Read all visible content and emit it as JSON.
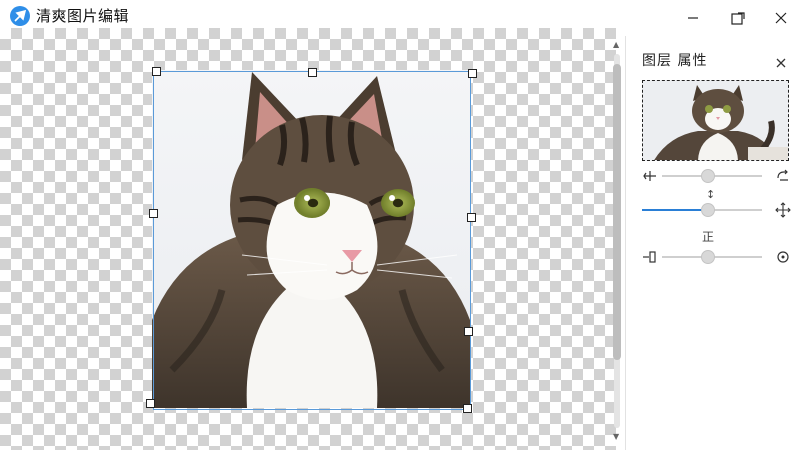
{
  "window": {
    "title": "清爽图片编辑",
    "controls": [
      "minimize",
      "maximize",
      "close"
    ]
  },
  "canvas": {
    "background": "transparency-checkerboard",
    "image_subject": "tabby-and-white cat portrait",
    "selection": "crop frame with 8 resize handles"
  },
  "panel": {
    "title": "图层 属性",
    "sliders": [
      {
        "name": "rotation",
        "value": 0.5,
        "left_icon": "split-arrows-icon",
        "right_icon": "rotate-icon"
      },
      {
        "name": "scale",
        "value": 0.5,
        "left_icon": "none",
        "right_icon": "move-icon",
        "marker": "↕"
      },
      {
        "name": "opacity",
        "value": 0.5,
        "left_icon": "opacity-icon",
        "right_icon": "reset-icon",
        "label": "正"
      }
    ]
  },
  "colors": {
    "accent": "#2a7fd6",
    "app_icon": "#2e8ee8",
    "crop_border": "#5a9ad8"
  }
}
